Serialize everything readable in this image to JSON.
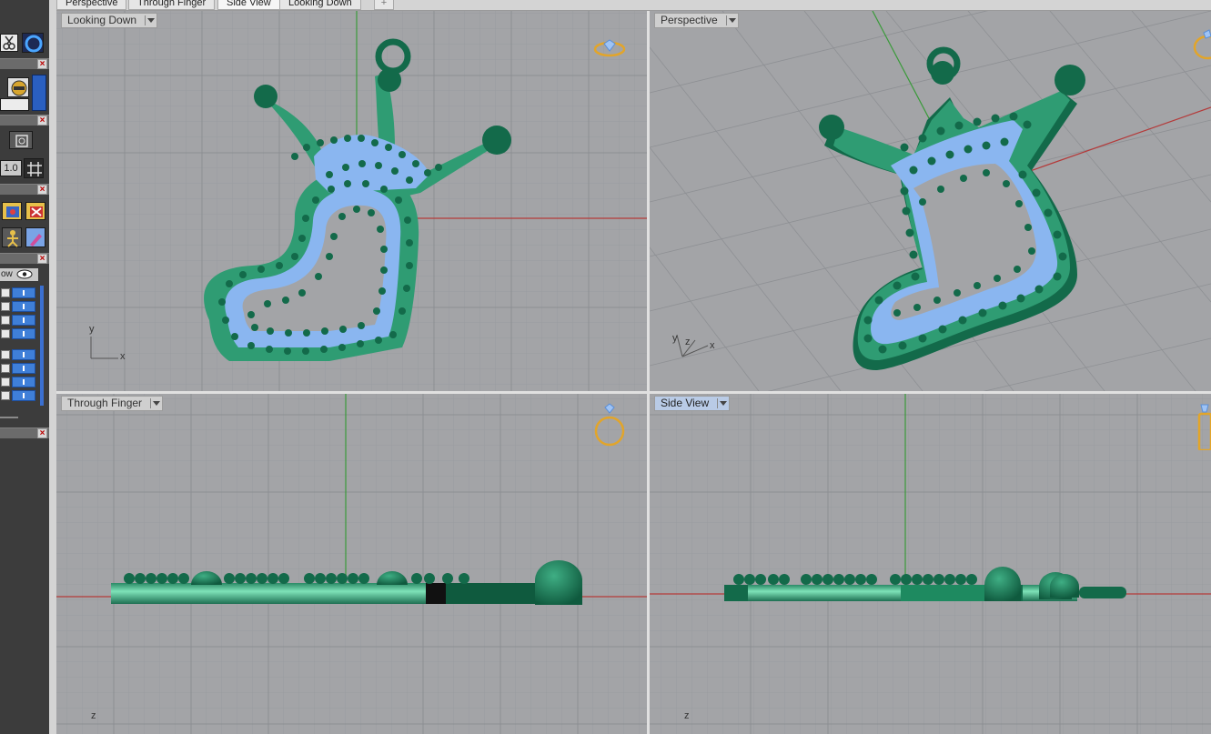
{
  "tabs": [
    {
      "label": "Perspective",
      "active": false
    },
    {
      "label": "Through Finger",
      "active": false
    },
    {
      "label": "Side View",
      "active": true
    },
    {
      "label": "Looking Down",
      "active": false
    }
  ],
  "tab_add_icon": "plus-icon",
  "left_toolbar": {
    "snap_value": "1.0",
    "layer_panel_label": "ow",
    "icons": [
      "scissors-icon",
      "circle-icon",
      "sphere-icon",
      "viewport-icon",
      "grid-snap-icon",
      "render-icon",
      "render-cancel-icon",
      "figure-icon",
      "pen-icon",
      "eye-icon",
      "lock-icon"
    ]
  },
  "viewports": {
    "top_left": {
      "label": "Looking Down",
      "corner_icon": "ring-top-icon",
      "axis_x": "x",
      "axis_y": "y"
    },
    "top_right": {
      "label": "Perspective",
      "corner_icon": "ring-perspective-icon",
      "axis_x": "x",
      "axis_y": "y",
      "axis_z": "z"
    },
    "bottom_left": {
      "label": "Through Finger",
      "corner_icon": "ring-front-icon",
      "axis_z": "z"
    },
    "bottom_right": {
      "label": "Side View",
      "corner_icon": "ring-side-icon",
      "axis_z": "z",
      "active": true
    }
  },
  "colors": {
    "viewport_bg": "#a3a4a7",
    "grid_minor": "#989a9d",
    "grid_major": "#8e9094",
    "axis_x": "#b43a3a",
    "axis_y": "#3a9a3a",
    "model_body": "#2f9c73",
    "model_dark": "#136a4a",
    "gem_fill": "#8ab6f0",
    "ring_icon": "#e2a52a"
  }
}
